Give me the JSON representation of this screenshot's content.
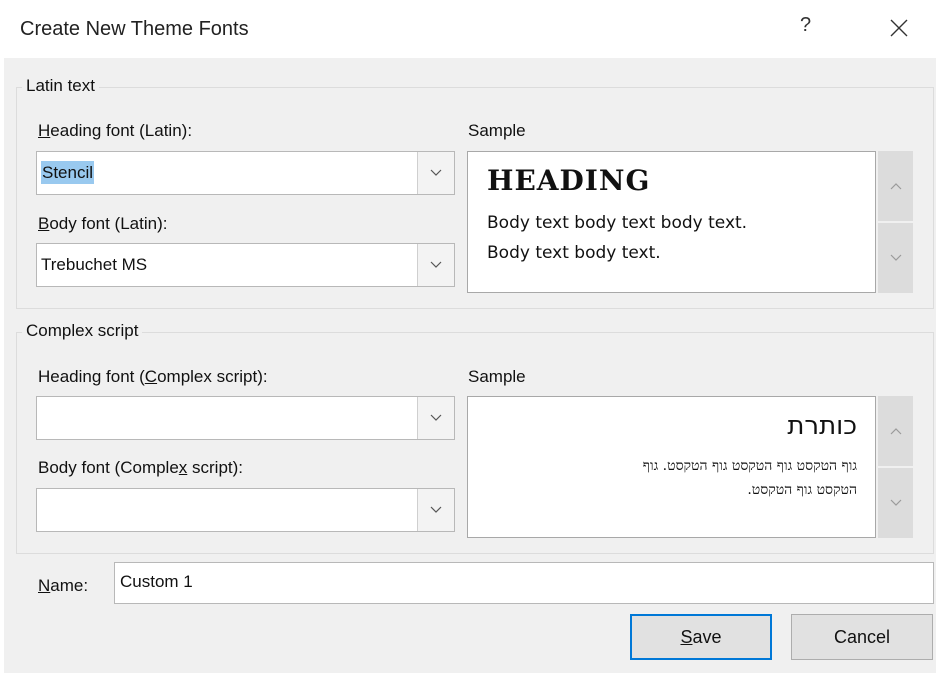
{
  "dialog": {
    "title": "Create New Theme Fonts",
    "help": "?",
    "close_icon": "close-icon"
  },
  "latin": {
    "group_label": "Latin text",
    "heading_label_prefix": "",
    "heading_label_u": "H",
    "heading_label_rest": "eading font (Latin):",
    "heading_value": "Stencil",
    "body_label_u": "B",
    "body_label_rest": "ody font (Latin):",
    "body_value": "Trebuchet MS",
    "sample_label": "Sample",
    "sample_heading": "HEADING",
    "sample_body_1": "Body text body text body text.",
    "sample_body_2": "Body text body text."
  },
  "complex": {
    "group_label": "Complex script",
    "heading_label_a": "Heading font (",
    "heading_label_u": "C",
    "heading_label_b": "omplex script):",
    "heading_value": "",
    "body_label_a": "Body font (Comple",
    "body_label_u": "x",
    "body_label_b": " script):",
    "body_value": "",
    "sample_label": "Sample",
    "sample_heading": "כותרת",
    "sample_body_1": "גוף הטקסט גוף הטקסט גוף הטקסט. גוף",
    "sample_body_2": "הטקסט גוף הטקסט."
  },
  "name": {
    "label_u": "N",
    "label_rest": "ame:",
    "value": "Custom 1"
  },
  "buttons": {
    "save_u": "S",
    "save_rest": "ave",
    "cancel": "Cancel"
  },
  "colors": {
    "selection": "#99c9ef",
    "primary_border": "#0078d7"
  }
}
